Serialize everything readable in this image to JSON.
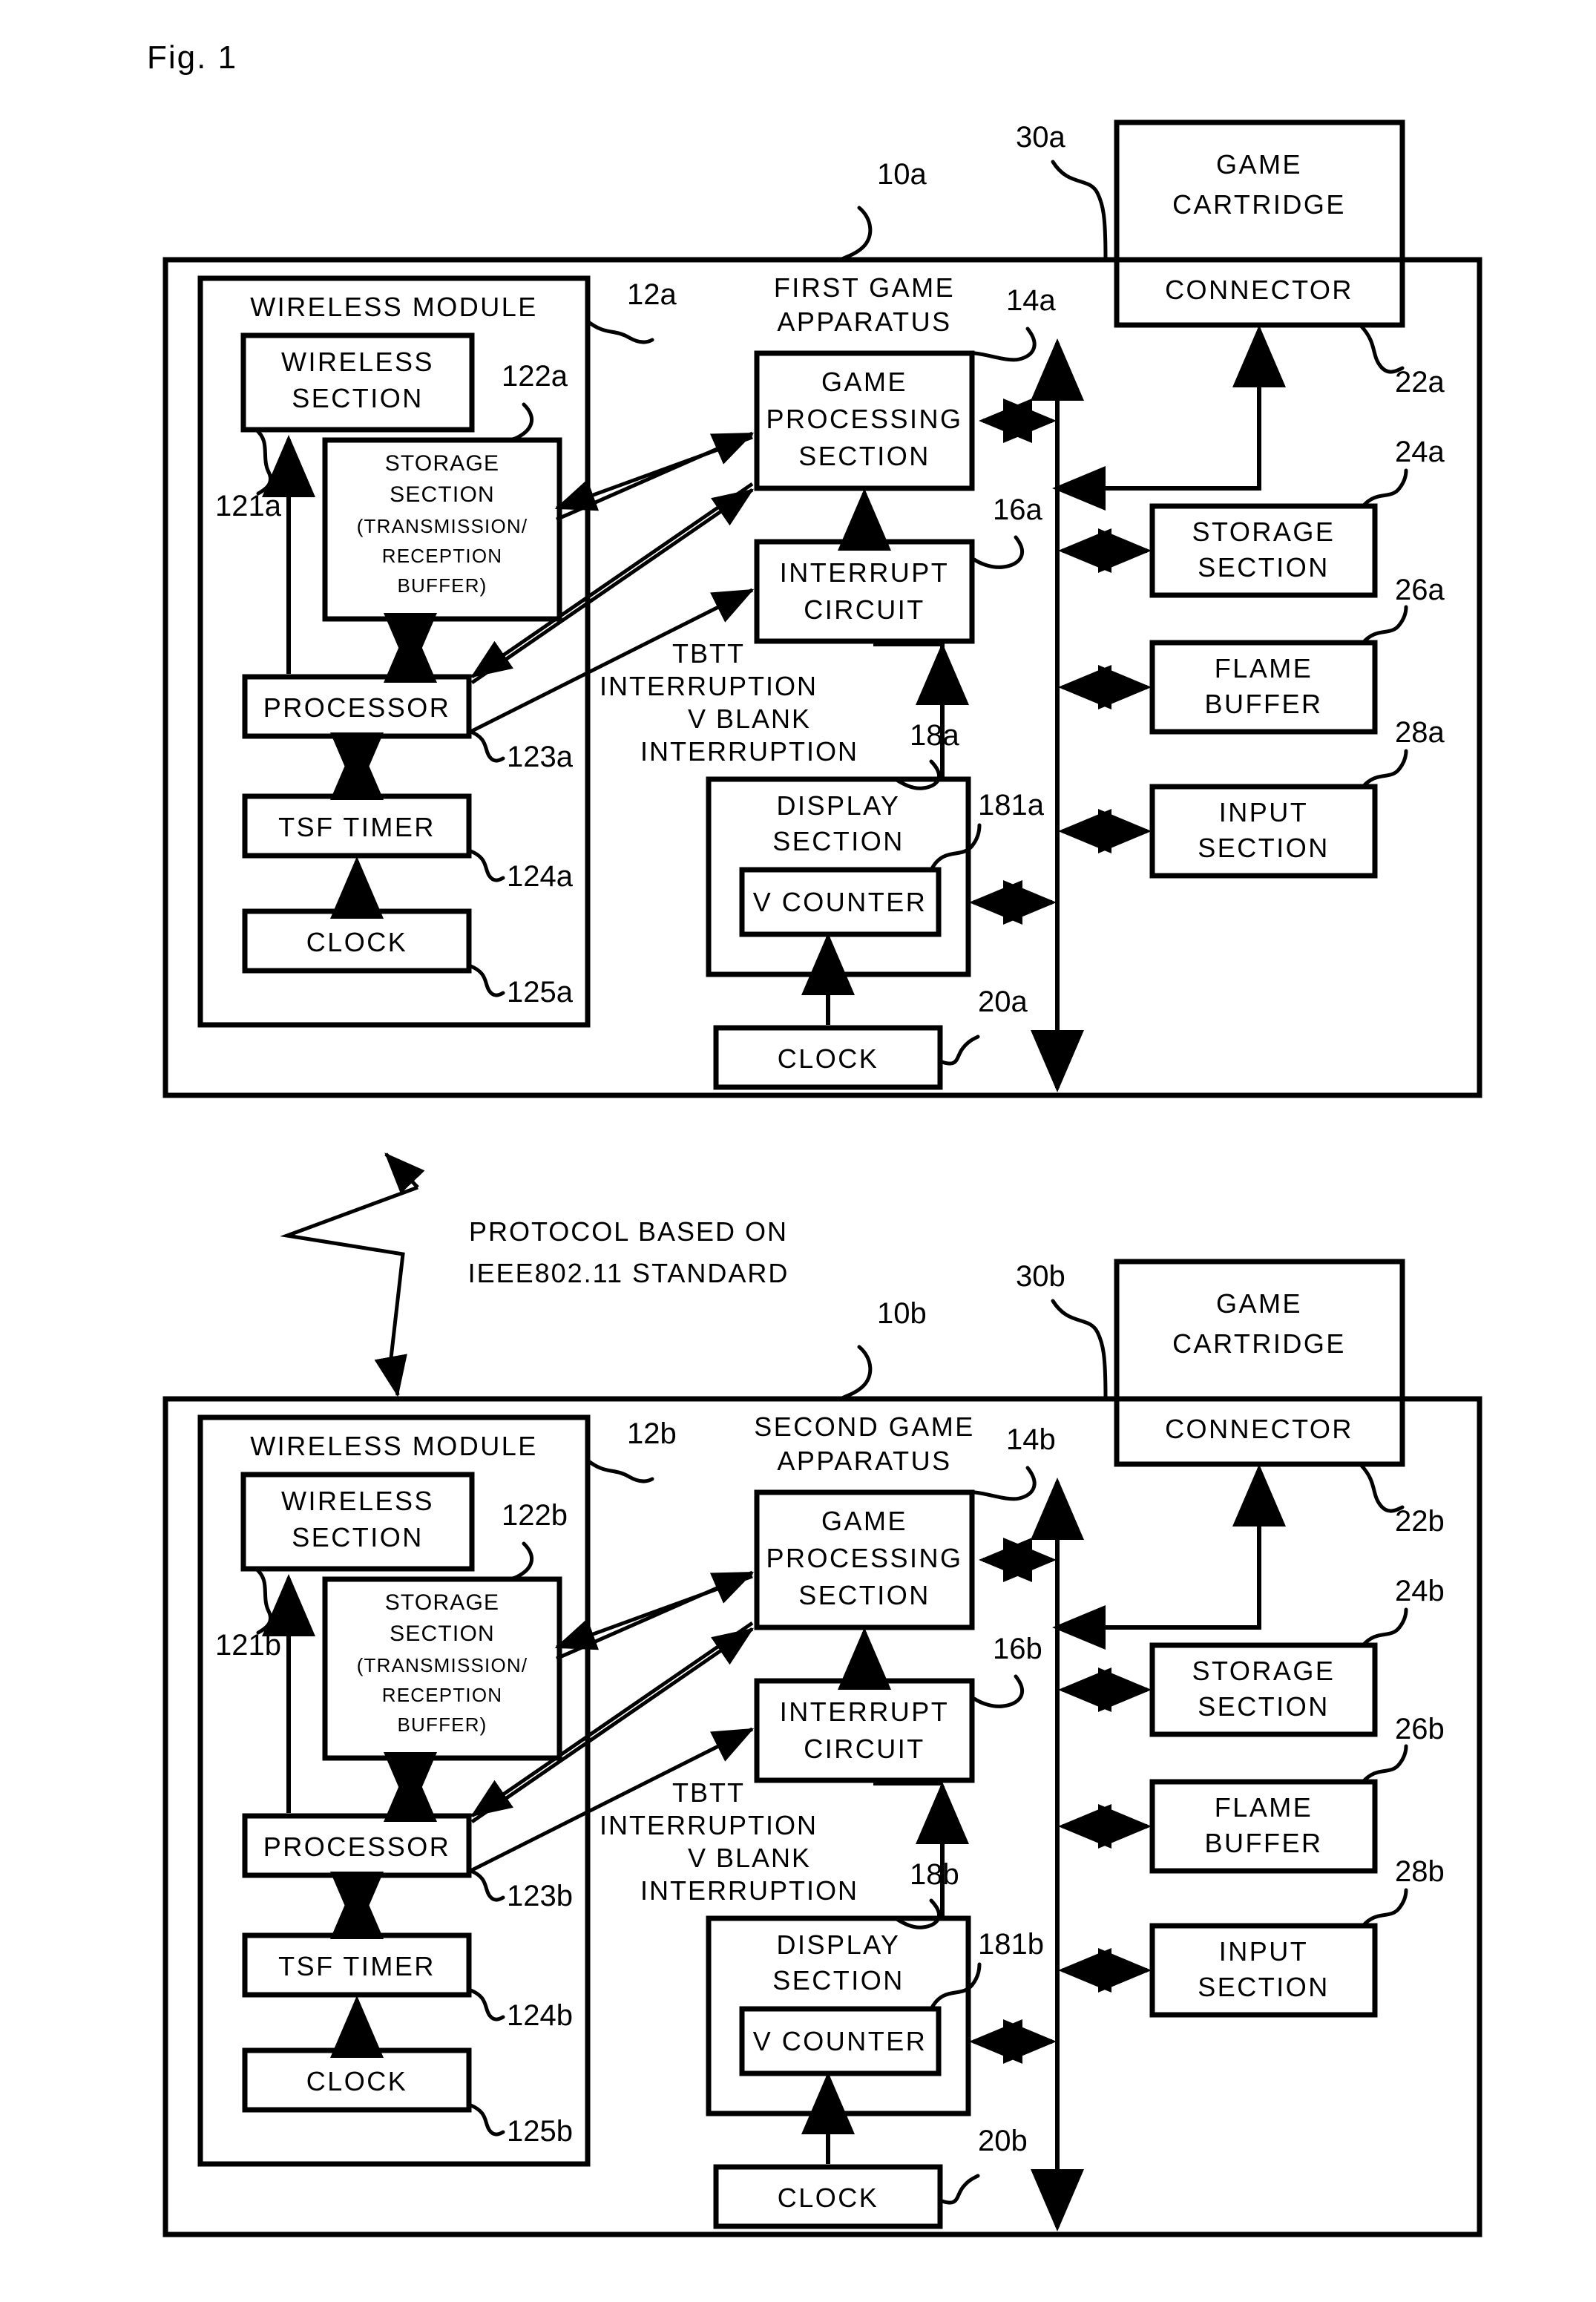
{
  "figure": {
    "caption": "Fig. 1"
  },
  "link_note": {
    "line1": "PROTOCOL BASED ON",
    "line2": "IEEE802.11 STANDARD"
  },
  "interrupt_note": {
    "line1": "TBTT",
    "line2": "INTERRUPTION",
    "line3": "V BLANK",
    "line4": "INTERRUPTION"
  },
  "apparatus": [
    {
      "id": "first",
      "title_line1": "FIRST GAME",
      "title_line2": "APPARATUS",
      "ref": "10a",
      "cartridge": {
        "line1": "GAME",
        "line2": "CARTRIDGE",
        "ref": "30a"
      },
      "connector": {
        "label": "CONNECTOR",
        "ref": "22a"
      },
      "wireless_module": {
        "title": "WIRELESS MODULE",
        "ref": "12a",
        "wireless_section": {
          "line1": "WIRELESS",
          "line2": "SECTION",
          "ref": "121a"
        },
        "storage_section": {
          "line1": "STORAGE",
          "line2": "SECTION",
          "line3": "(TRANSMISSION/",
          "line4": "RECEPTION",
          "line5": "BUFFER)",
          "ref": "122a"
        },
        "processor": {
          "label": "PROCESSOR",
          "ref": "123a"
        },
        "tsf_timer": {
          "label": "TSF TIMER",
          "ref": "124a"
        },
        "clock": {
          "label": "CLOCK",
          "ref": "125a"
        }
      },
      "game_processing_section": {
        "line1": "GAME",
        "line2": "PROCESSING",
        "line3": "SECTION",
        "ref": "14a"
      },
      "interrupt_circuit": {
        "line1": "INTERRUPT",
        "line2": "CIRCUIT",
        "ref": "16a"
      },
      "display_section": {
        "line1": "DISPLAY",
        "line2": "SECTION",
        "ref": "18a"
      },
      "v_counter": {
        "label": "V COUNTER",
        "ref": "181a"
      },
      "display_clock": {
        "label": "CLOCK",
        "ref": "20a"
      },
      "storage_section": {
        "line1": "STORAGE",
        "line2": "SECTION",
        "ref": "24a"
      },
      "flame_buffer": {
        "line1": "FLAME",
        "line2": "BUFFER",
        "ref": "26a"
      },
      "input_section": {
        "line1": "INPUT",
        "line2": "SECTION",
        "ref": "28a"
      }
    },
    {
      "id": "second",
      "title_line1": "SECOND GAME",
      "title_line2": "APPARATUS",
      "ref": "10b",
      "cartridge": {
        "line1": "GAME",
        "line2": "CARTRIDGE",
        "ref": "30b"
      },
      "connector": {
        "label": "CONNECTOR",
        "ref": "22b"
      },
      "wireless_module": {
        "title": "WIRELESS MODULE",
        "ref": "12b",
        "wireless_section": {
          "line1": "WIRELESS",
          "line2": "SECTION",
          "ref": "121b"
        },
        "storage_section": {
          "line1": "STORAGE",
          "line2": "SECTION",
          "line3": "(TRANSMISSION/",
          "line4": "RECEPTION",
          "line5": "BUFFER)",
          "ref": "122b"
        },
        "processor": {
          "label": "PROCESSOR",
          "ref": "123b"
        },
        "tsf_timer": {
          "label": "TSF TIMER",
          "ref": "124b"
        },
        "clock": {
          "label": "CLOCK",
          "ref": "125b"
        }
      },
      "game_processing_section": {
        "line1": "GAME",
        "line2": "PROCESSING",
        "line3": "SECTION",
        "ref": "14b"
      },
      "interrupt_circuit": {
        "line1": "INTERRUPT",
        "line2": "CIRCUIT",
        "ref": "16b"
      },
      "display_section": {
        "line1": "DISPLAY",
        "line2": "SECTION",
        "ref": "18b"
      },
      "v_counter": {
        "label": "V COUNTER",
        "ref": "181b"
      },
      "display_clock": {
        "label": "CLOCK",
        "ref": "20b"
      },
      "storage_section": {
        "line1": "STORAGE",
        "line2": "SECTION",
        "ref": "24b"
      },
      "flame_buffer": {
        "line1": "FLAME",
        "line2": "BUFFER",
        "ref": "26b"
      },
      "input_section": {
        "line1": "INPUT",
        "line2": "SECTION",
        "ref": "28b"
      }
    }
  ]
}
